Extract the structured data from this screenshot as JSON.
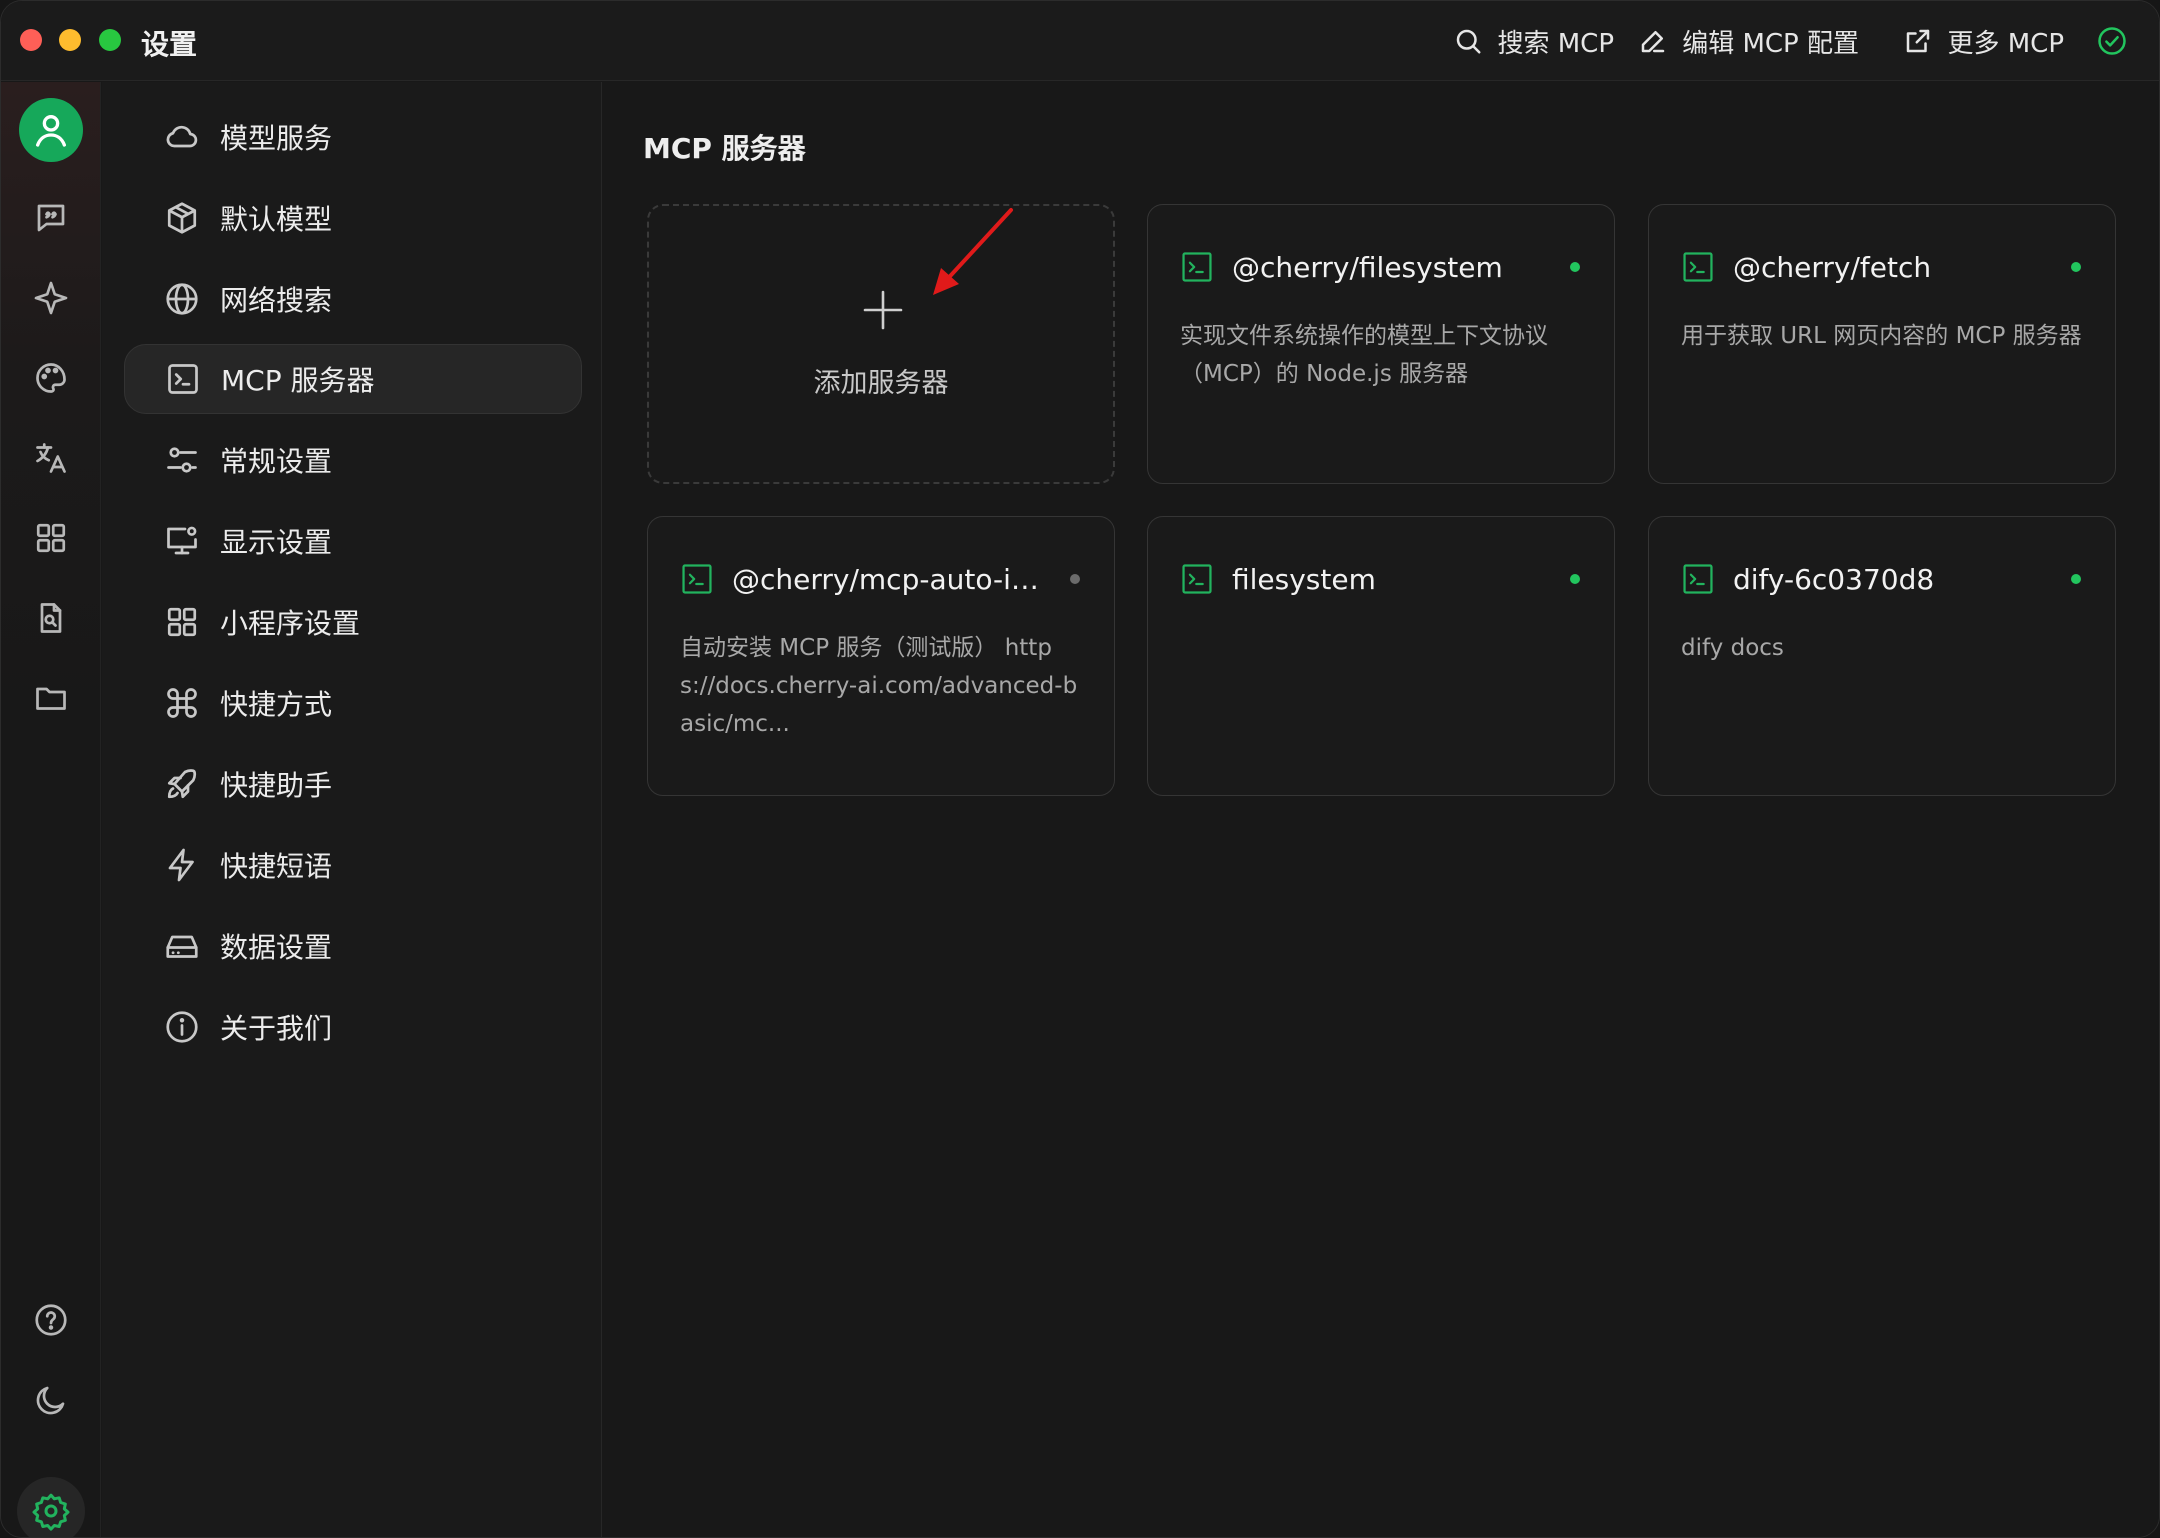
{
  "window": {
    "title": "设置"
  },
  "toolbar": {
    "search_label": "搜索 MCP",
    "edit_label": "编辑 MCP 配置",
    "more_label": "更多 MCP"
  },
  "rail": {
    "items": [
      "avatar-icon",
      "chat-icon",
      "sparkle-icon",
      "palette-icon",
      "translate-icon",
      "apps-icon",
      "document-search-icon",
      "folder-icon"
    ],
    "bottom": [
      "help-icon",
      "moon-icon",
      "gear-icon"
    ]
  },
  "menu": {
    "items": [
      {
        "label": "模型服务",
        "icon": "cloud-icon"
      },
      {
        "label": "默认模型",
        "icon": "cube-icon"
      },
      {
        "label": "网络搜索",
        "icon": "globe-icon"
      },
      {
        "label": "MCP 服务器",
        "icon": "terminal-icon",
        "active": true
      },
      {
        "label": "常规设置",
        "icon": "sliders-icon"
      },
      {
        "label": "显示设置",
        "icon": "monitor-settings-icon"
      },
      {
        "label": "小程序设置",
        "icon": "grid-icon"
      },
      {
        "label": "快捷方式",
        "icon": "command-icon"
      },
      {
        "label": "快捷助手",
        "icon": "rocket-icon"
      },
      {
        "label": "快捷短语",
        "icon": "lightning-icon"
      },
      {
        "label": "数据设置",
        "icon": "hard-drive-icon"
      },
      {
        "label": "关于我们",
        "icon": "info-icon"
      }
    ]
  },
  "main": {
    "title": "MCP 服务器",
    "add_label": "添加服务器",
    "servers": [
      {
        "name": "@cherry/filesystem",
        "description": "实现文件系统操作的模型上下文协议（MCP）的 Node.js 服务器",
        "status": "active"
      },
      {
        "name": "@cherry/fetch",
        "description": "用于获取 URL 网页内容的 MCP 服务器",
        "status": "active"
      },
      {
        "name": "@cherry/mcp-auto-in...",
        "description": "自动安装 MCP 服务（测试版） https://docs.cherry-ai.com/advanced-basic/mc...",
        "status": "inactive"
      },
      {
        "name": "filesystem",
        "description": "",
        "status": "active"
      },
      {
        "name": "dify-6c0370d8",
        "description": "dify docs",
        "status": "active"
      }
    ]
  },
  "colors": {
    "accent": "#22b35e",
    "active_dot": "#22c55e",
    "inactive_dot": "#6b6b6b",
    "annotation_arrow": "#e01a1a"
  }
}
